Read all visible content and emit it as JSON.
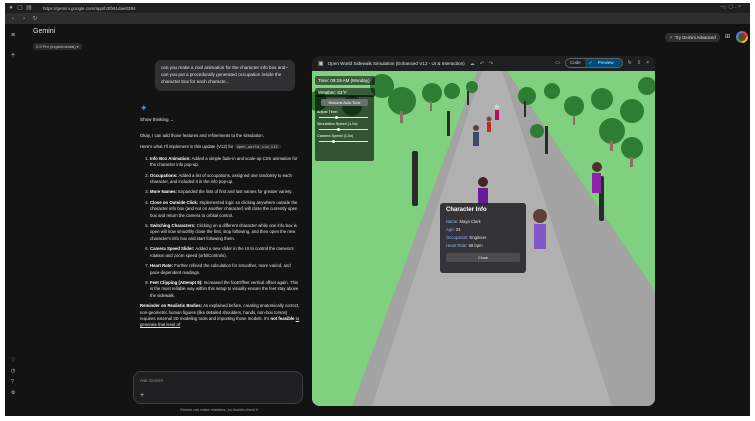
{
  "browser": {
    "tab_title": "Gemini",
    "url": "https://gemini.google.com/app/b3fb61dae0384"
  },
  "gemini": {
    "brand": "Gemini",
    "model": "2.5 Pro (experimental) ▾",
    "try_advanced": "Try Gemini Advanced"
  },
  "chat": {
    "user_message": "can you make a cool animation for the character info box and can you put a procedurally generated occupation inside the character box for each characte...",
    "thinking_label": "Show thinking ⌄",
    "intro": "Okay, I can add those features and refinements to the simulation.",
    "update_prefix": "Here's what I'll implement in this update (V12) for",
    "update_code": "open_world_sim_v12",
    "items": [
      {
        "title": "Info Box Animation:",
        "text": "Added a simple fade-in and scale-up CSS animation for the character info pop-up."
      },
      {
        "title": "Occupations:",
        "text": "Added a list of occupations, assigned one randomly to each character, and included it in the info pop-up."
      },
      {
        "title": "More Names:",
        "text": "Expanded the lists of first and last names for greater variety."
      },
      {
        "title": "Close on Outside Click:",
        "text": "Implemented logic so clicking anywhere outside the character info box (and not on another character) will close the currently open box and return the camera to orbital control."
      },
      {
        "title": "Switching Characters:",
        "text": "Clicking on a different character while one info box is open will now smoothly close the first, stop following, and then open the new character's info box and start following them."
      },
      {
        "title": "Camera Speed Slider:",
        "text": "Added a new slider in the UI to control the camera's rotation and zoom speed (orbitControls)."
      },
      {
        "title": "Heart Rate:",
        "text": "Further refined the calculation for smoother, more varied, and pace-dependent readings."
      },
      {
        "title": "Feet Clipping (Attempt 9):",
        "text": "Increased the footOffset vertical offset again. This is the most reliable way within this setup to visually ensure the feet stay above the sidewalk."
      }
    ],
    "reminder_title": "Reminder on Realistic Bodies:",
    "reminder_text": "As explained before, creating anatomically correct, non-geometric human figures (like detailed shoulders, hands, non-box torsos) requires external 3D modeling tools and importing those models. It's",
    "reminder_bold": "not feasible",
    "reminder_tail": "to generate that level of",
    "input_placeholder": "Ask Gemini",
    "disclaimer": "Gemini can make mistakes, so double-check it"
  },
  "canvas": {
    "title": "Open World Sidewalk Simulation (Enhanced V12 - UI & Interaction)",
    "code_tab": "Code",
    "preview_tab": "Preview",
    "hud": {
      "time": "Time: 09:19 AM (Monday)",
      "weather": "Weather: 63°F",
      "resume_button": "Resume Auto Time",
      "adjust_time": "Adjust Time:",
      "adjust_time_level": 0.35,
      "sim_speed": "Simulation Speed (1.0x)",
      "sim_speed_level": 0.4,
      "camera_speed": "Camera Speed (1.0x)",
      "camera_speed_level": 0.3
    },
    "info_box": {
      "heading": "Character Info",
      "name_key": "Name:",
      "name_val": "Maya Clark",
      "age_key": "Age:",
      "age_val": "34",
      "occ_key": "Occupation:",
      "occ_val": "Engineer",
      "hr_key": "Heart Rate:",
      "hr_val": "69 bpm",
      "close_label": "Close"
    }
  },
  "colors": {
    "sky": "#b7dbf0",
    "grass": "#7fd17f",
    "sidewalk": "#9e9e9e",
    "accent": "#8ab4f8",
    "gemini_spark": "#4f8df5"
  }
}
